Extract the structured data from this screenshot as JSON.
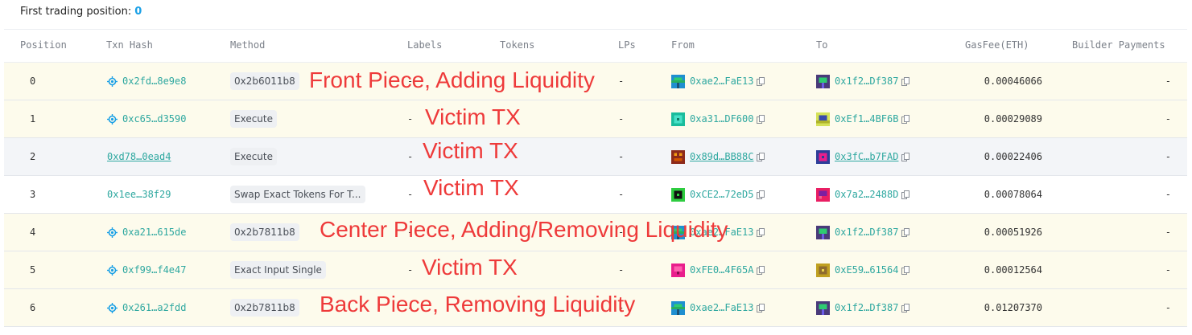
{
  "header": {
    "label": "First trading position:",
    "value": "0"
  },
  "columns": {
    "position": "Position",
    "txn_hash": "Txn Hash",
    "method": "Method",
    "labels": "Labels",
    "tokens": "Tokens",
    "lps": "LPs",
    "from": "From",
    "to": "To",
    "gas_fee": "GasFee(ETH)",
    "builder_payments": "Builder Payments"
  },
  "rows": [
    {
      "position": "0",
      "txn": "0x2fd…8e9e8",
      "method": "0x2b6011b8",
      "labels": "-",
      "lps": "-",
      "from": "0xae2…FaE13",
      "to": "0x1f2…Df387",
      "gas": "0.00046066",
      "builder": "-"
    },
    {
      "position": "1",
      "txn": "0xc65…d3590",
      "method": "Execute",
      "labels": "-",
      "lps": "-",
      "from": "0xa31…DF600",
      "to": "0xEf1…4BF6B",
      "gas": "0.00029089",
      "builder": "-"
    },
    {
      "position": "2",
      "txn": "0xd78…0ead4",
      "method": "Execute",
      "labels": "-",
      "lps": "-",
      "from": "0x89d…BB88C",
      "to": "0x3fC…b7FAD",
      "gas": "0.00022406",
      "builder": "-"
    },
    {
      "position": "3",
      "txn": "0x1ee…38f29",
      "method": "Swap Exact Tokens For T...",
      "labels": "-",
      "lps": "-",
      "from": "0xCE2…72eD5",
      "to": "0x7a2…2488D",
      "gas": "0.00078064",
      "builder": "-"
    },
    {
      "position": "4",
      "txn": "0xa21…615de",
      "method": "0x2b7811b8",
      "labels": "-",
      "lps": "-",
      "from": "0xae2…FaE13",
      "to": "0x1f2…Df387",
      "gas": "0.00051926",
      "builder": "-"
    },
    {
      "position": "5",
      "txn": "0xf99…f4e47",
      "method": "Exact Input Single",
      "labels": "-",
      "lps": "-",
      "from": "0xFE0…4F65A",
      "to": "0xE59…61564",
      "gas": "0.00012564",
      "builder": "-"
    },
    {
      "position": "6",
      "txn": "0x261…a2fdd",
      "method": "0x2b7811b8",
      "labels": "-",
      "lps": "-",
      "from": "0xae2…FaE13",
      "to": "0x1f2…Df387",
      "gas": "0.01207370",
      "builder": "-"
    }
  ],
  "annotations": [
    "Front Piece, Adding Liquidity",
    "Victim TX",
    "Victim TX",
    "Victim TX",
    "Center Piece, Adding/Removing Liquidity",
    "Victim TX",
    "Back Piece, Removing Liquidity"
  ],
  "colors": {
    "accent": "#1aa0e6",
    "link": "#2fa8a0",
    "annotation": "#ee3a3a"
  }
}
